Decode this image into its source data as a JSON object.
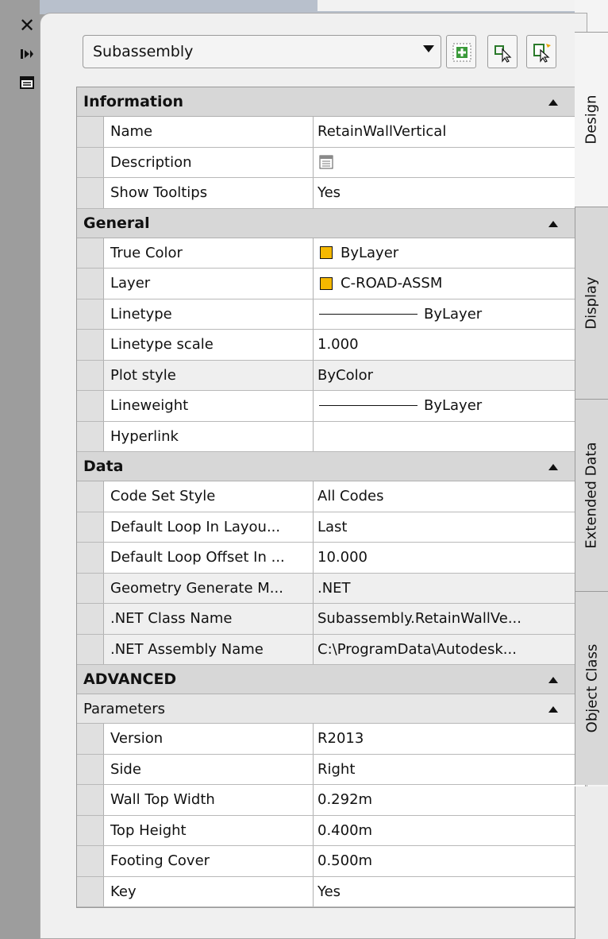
{
  "panel": {
    "object_type": "Subassembly"
  },
  "left_bar": {
    "icons": [
      "close-icon",
      "auto-hide-icon",
      "properties-menu-icon"
    ]
  },
  "toolbar": {
    "buttons": [
      "toggle-pickadd-icon",
      "select-objects-icon",
      "quick-select-icon"
    ]
  },
  "sections": {
    "information": {
      "title": "Information",
      "rows": [
        {
          "name": "Name",
          "value": "RetainWallVertical"
        },
        {
          "name": "Description",
          "value": ""
        },
        {
          "name": "Show Tooltips",
          "value": "Yes"
        }
      ]
    },
    "general": {
      "title": "General",
      "rows": [
        {
          "name": "True Color",
          "value": "ByLayer"
        },
        {
          "name": "Layer",
          "value": "C-ROAD-ASSM"
        },
        {
          "name": "Linetype",
          "value": "ByLayer"
        },
        {
          "name": "Linetype scale",
          "value": "1.000"
        },
        {
          "name": "Plot style",
          "value": "ByColor"
        },
        {
          "name": "Lineweight",
          "value": "ByLayer"
        },
        {
          "name": "Hyperlink",
          "value": ""
        }
      ]
    },
    "data": {
      "title": "Data",
      "rows": [
        {
          "name": "Code Set Style",
          "value": "All Codes"
        },
        {
          "name": "Default Loop In Layou...",
          "value": "Last"
        },
        {
          "name": "Default Loop Offset In ...",
          "value": "10.000"
        },
        {
          "name": "Geometry Generate M...",
          "value": ".NET"
        },
        {
          "name": ".NET Class Name",
          "value": "Subassembly.RetainWallVe..."
        },
        {
          "name": ".NET Assembly Name",
          "value": "C:\\ProgramData\\Autodesk..."
        }
      ]
    },
    "advanced": {
      "title": "ADVANCED",
      "parameters": {
        "title": "Parameters",
        "rows": [
          {
            "name": "Version",
            "value": "R2013"
          },
          {
            "name": "Side",
            "value": "Right"
          },
          {
            "name": "Wall Top Width",
            "value": "0.292m"
          },
          {
            "name": "Top Height",
            "value": "0.400m"
          },
          {
            "name": "Footing Cover",
            "value": "0.500m"
          },
          {
            "name": "Key",
            "value": "Yes"
          }
        ]
      }
    }
  },
  "tabs": [
    {
      "label": "Design"
    },
    {
      "label": "Display"
    },
    {
      "label": "Extended Data"
    },
    {
      "label": "Object Class"
    }
  ],
  "colors": {
    "swatch": "#f5b800"
  }
}
